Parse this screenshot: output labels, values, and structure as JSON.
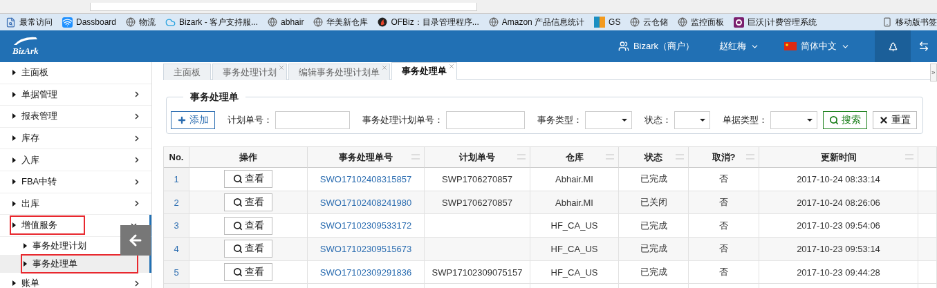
{
  "browser": {
    "bookmarks": [
      {
        "label": "最常访问",
        "kind": "page"
      },
      {
        "label": "Dassboard",
        "kind": "wifi"
      },
      {
        "label": "物流",
        "kind": "globe"
      },
      {
        "label": "Bizark - 客户支持服...",
        "kind": "cloud"
      },
      {
        "label": "abhair",
        "kind": "globe"
      },
      {
        "label": "华美新仓库",
        "kind": "globe"
      },
      {
        "label": "OFBiz：目录管理程序...",
        "kind": "flame"
      },
      {
        "label": "Amazon 产品信息统计",
        "kind": "globe"
      },
      {
        "label": "GS",
        "kind": "split"
      },
      {
        "label": "云仓储",
        "kind": "globe"
      },
      {
        "label": "监控面板",
        "kind": "globe"
      },
      {
        "label": "巨沃|计费管理系统",
        "kind": "ring"
      }
    ],
    "mobile_bookmarks": "移动版书签"
  },
  "header": {
    "logo": "BizArk",
    "account": "Bizark（商户）",
    "user": "赵红梅",
    "language": "简体中文"
  },
  "sidebar": {
    "items": [
      {
        "label": "主面板",
        "expandable": false,
        "expanded": false,
        "annotated": false
      },
      {
        "label": "单据管理",
        "expandable": true,
        "expanded": false,
        "annotated": false
      },
      {
        "label": "报表管理",
        "expandable": true,
        "expanded": false,
        "annotated": false
      },
      {
        "label": "库存",
        "expandable": true,
        "expanded": false,
        "annotated": false
      },
      {
        "label": "入库",
        "expandable": true,
        "expanded": false,
        "annotated": false
      },
      {
        "label": "FBA中转",
        "expandable": true,
        "expanded": false,
        "annotated": false
      },
      {
        "label": "出库",
        "expandable": true,
        "expanded": false,
        "annotated": false
      },
      {
        "label": "增值服务",
        "expandable": true,
        "expanded": true,
        "annotated": true,
        "children": [
          {
            "label": "事务处理计划",
            "selected": false,
            "annotated": false
          },
          {
            "label": "事务处理单",
            "selected": true,
            "annotated": true
          }
        ]
      },
      {
        "label": "账单",
        "expandable": true,
        "expanded": false,
        "annotated": false
      }
    ]
  },
  "tabs": [
    {
      "label": "主面板",
      "selected": false,
      "closable": false
    },
    {
      "label": "事务处理计划",
      "selected": false,
      "closable": true
    },
    {
      "label": "编辑事务处理计划单",
      "selected": false,
      "closable": true
    },
    {
      "label": "事务处理单",
      "selected": true,
      "closable": true
    }
  ],
  "filter": {
    "title": "事务处理单",
    "add_button": "添加",
    "fields": [
      {
        "kind": "text",
        "label": "计划单号："
      },
      {
        "kind": "text",
        "label": "事务处理计划单号："
      },
      {
        "kind": "select",
        "label": "事务类型："
      },
      {
        "kind": "select",
        "label": "状态："
      },
      {
        "kind": "select",
        "label": "单据类型："
      }
    ],
    "search_button": "搜索",
    "reset_button": "重置"
  },
  "table": {
    "columns": [
      "No.",
      "操作",
      "事务处理单号",
      "计划单号",
      "仓库",
      "状态",
      "取消?",
      "更新时间"
    ],
    "rows": [
      {
        "no": "1",
        "action": "查看",
        "order": "SWO17102408315857",
        "plan": "SWP1706270857",
        "warehouse": "Abhair.MI",
        "status": "已完成",
        "cancelled": "否",
        "updated": "2017-10-24 08:33:14"
      },
      {
        "no": "2",
        "action": "查看",
        "order": "SWO17102408241980",
        "plan": "SWP1706270857",
        "warehouse": "Abhair.MI",
        "status": "已关闭",
        "cancelled": "否",
        "updated": "2017-10-24 08:26:06"
      },
      {
        "no": "3",
        "action": "查看",
        "order": "SWO17102309533172",
        "warehouse": "HF_CA_US",
        "status": "已完成",
        "cancelled": "否",
        "updated": "2017-10-23 09:54:06"
      },
      {
        "no": "4",
        "action": "查看",
        "order": "SWO17102309515673",
        "warehouse": "HF_CA_US",
        "status": "已完成",
        "cancelled": "否",
        "updated": "2017-10-23 09:53:14"
      },
      {
        "no": "5",
        "action": "查看",
        "order": "SWO17102309291836",
        "plan": "SWP17102309075157",
        "warehouse": "HF_CA_US",
        "status": "已完成",
        "cancelled": "否",
        "updated": "2017-10-23 09:44:28"
      }
    ]
  }
}
